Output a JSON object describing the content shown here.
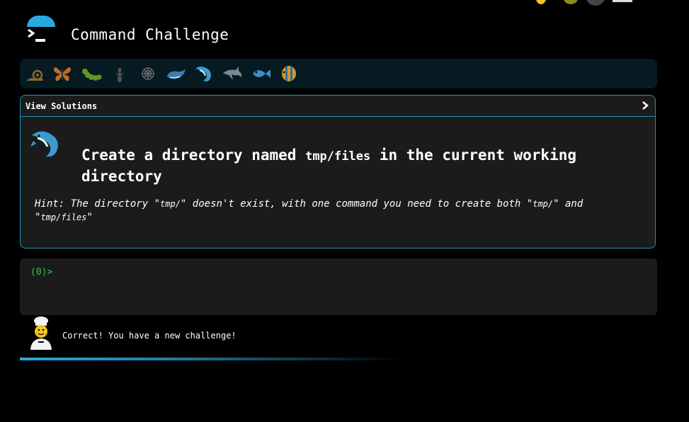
{
  "header": {
    "title": "Command Challenge",
    "logo_icon": "terminal-icon"
  },
  "levels": [
    {
      "icon": "snail-icon",
      "color": "#8a6a2a"
    },
    {
      "icon": "butterfly-icon",
      "color": "#c46a20"
    },
    {
      "icon": "caterpillar-icon",
      "color": "#5c9a20"
    },
    {
      "icon": "ant-icon",
      "color": "#555555"
    },
    {
      "icon": "spider-web-icon",
      "color": "#777777"
    },
    {
      "icon": "whale-icon",
      "color": "#3a7fb0"
    },
    {
      "icon": "whale-icon",
      "color": "#3a9ad0"
    },
    {
      "icon": "dolphin-icon",
      "color": "#7a8a95"
    },
    {
      "icon": "fish-icon",
      "color": "#3a8fc8"
    },
    {
      "icon": "tropical-fish-icon",
      "color": "#d49a20"
    }
  ],
  "panel": {
    "view_solutions": "View Solutions",
    "challenge_prefix": "Create a directory named ",
    "challenge_code": "tmp/files",
    "challenge_suffix": " in the current working directory",
    "hint_part1": "Hint: The directory \"",
    "hint_code1": "tmp/",
    "hint_part2": "\" doesn't exist, with one command you need to create both \"",
    "hint_code2": "tmp/",
    "hint_part3": "\" and \"",
    "hint_code3": "tmp/files",
    "hint_part4": "\""
  },
  "terminal": {
    "prompt": "(0)>"
  },
  "status": {
    "message": "Correct! You have a new challenge!",
    "avatar_icon": "chef-icon",
    "progress_fraction": 0.6
  },
  "colors": {
    "accent": "#29a8e0",
    "border": "#1d93b6",
    "prompt": "#2ecc40",
    "panel_bg": "#1b1b1b"
  }
}
